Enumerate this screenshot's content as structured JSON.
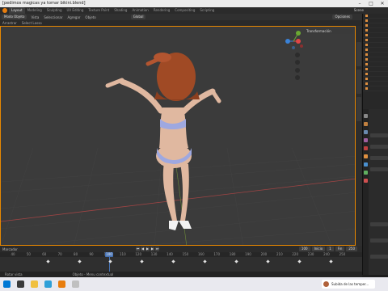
{
  "window": {
    "title": "[pedimos magicas ya tomar bikini.blend]"
  },
  "menu": {
    "workspaces": [
      "Layout",
      "Modeling",
      "Sculpting",
      "UV Editing",
      "Texture Paint",
      "Shading",
      "Animation",
      "Rendering",
      "Compositing",
      "Scripting"
    ],
    "active_workspace": "Layout",
    "scene": "Scene"
  },
  "viewport_header": {
    "mode": "Modo Objeto",
    "view": "Vista",
    "select": "Seleccionar",
    "add": "Agregar",
    "object": "Objeto",
    "orientation": "Global",
    "options": "Opciones",
    "transform_panel": "Transformación"
  },
  "viewport_header2": {
    "drag": "Arrastrar",
    "select_box": "Select Lasso"
  },
  "timeline": {
    "label": "Marcador",
    "ticks": [
      "40",
      "50",
      "60",
      "70",
      "80",
      "90",
      "100",
      "110",
      "120",
      "130",
      "140",
      "150",
      "160",
      "170",
      "180",
      "190",
      "200",
      "210",
      "220",
      "230",
      "240",
      "250"
    ],
    "current_frame": "100",
    "start": "Inicio",
    "start_value": "1",
    "end": "Fin",
    "end_value": "250"
  },
  "statusbar": {
    "left": "Rotar vista",
    "middle": "Objeto - Menu contextual"
  },
  "taskbar": {
    "notification": "Subida de las temper..."
  },
  "colors": {
    "accent": "#e88800",
    "blender_logo": "#e87d0d",
    "timeline_cursor": "#4772b3",
    "viewport_bg": "#3b3b3b",
    "hair": "#a04a25",
    "skin": "#e0b8a0",
    "bikini": "#9ea8e0"
  },
  "icons": [
    "blender-logo-icon",
    "axis-gizmo-icon",
    "zoom-icon",
    "hand-icon",
    "camera-icon",
    "grid-icon",
    "play-icon",
    "keyframe-icon",
    "folder-icon",
    "edge-browser-icon",
    "windows-start-icon"
  ]
}
